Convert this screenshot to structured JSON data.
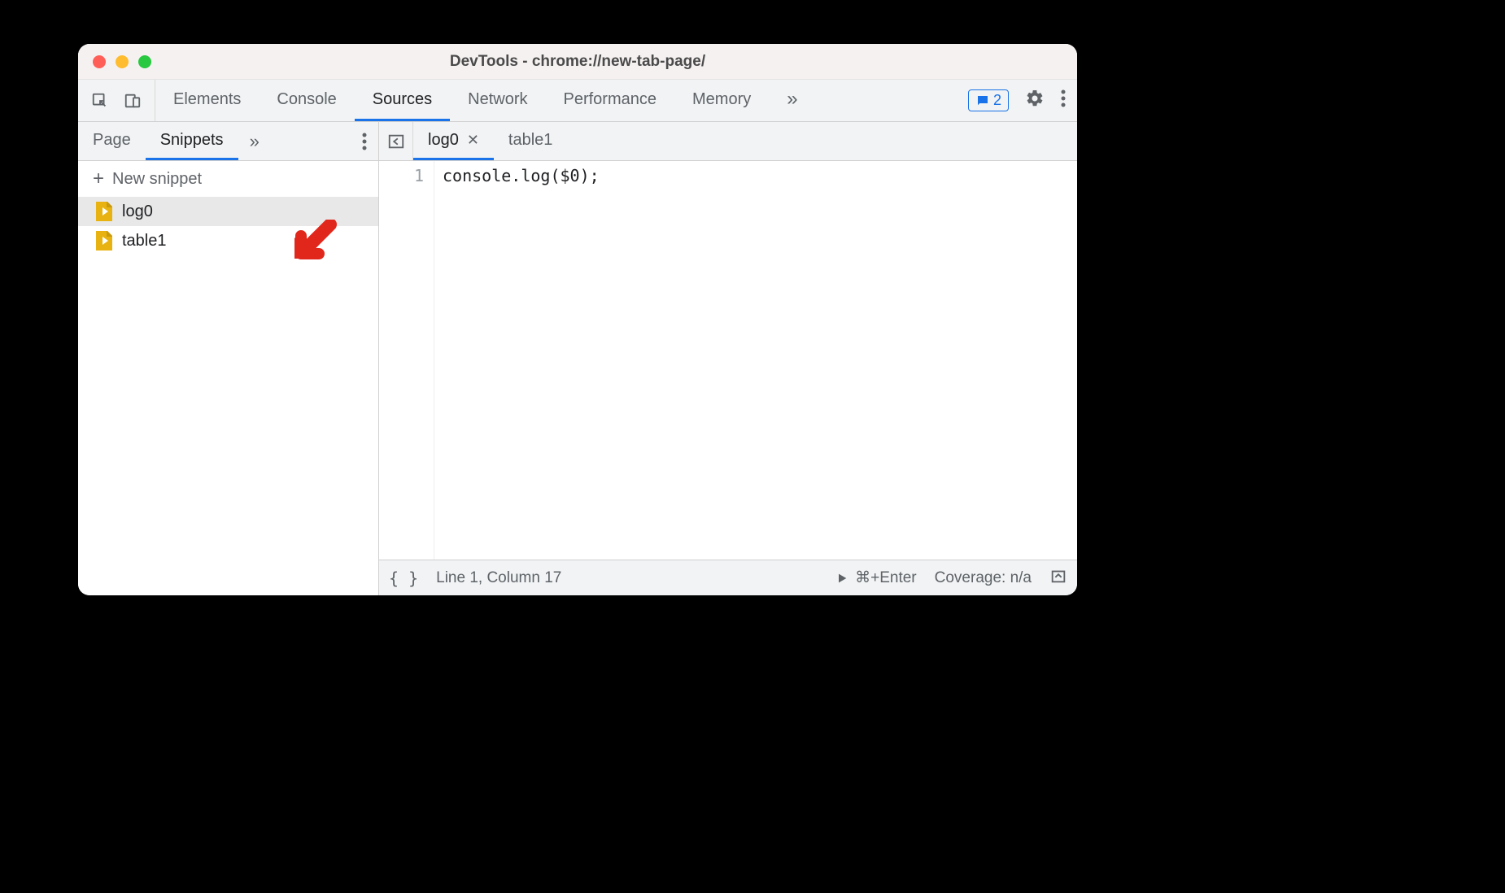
{
  "window": {
    "title": "DevTools - chrome://new-tab-page/"
  },
  "toolbar": {
    "tabs": [
      "Elements",
      "Console",
      "Sources",
      "Network",
      "Performance",
      "Memory"
    ],
    "active": "Sources",
    "overflowGlyph": "»",
    "badgeCount": "2"
  },
  "sidebar": {
    "tabs": [
      "Page",
      "Snippets"
    ],
    "active": "Snippets",
    "overflowGlyph": "»",
    "newSnippetLabel": "New snippet",
    "files": [
      {
        "name": "log0",
        "selected": true
      },
      {
        "name": "table1",
        "selected": false
      }
    ]
  },
  "editor": {
    "tabs": [
      {
        "name": "log0",
        "active": true,
        "closable": true
      },
      {
        "name": "table1",
        "active": false,
        "closable": false
      }
    ],
    "lineNumber": "1",
    "code": "console.log($0);"
  },
  "status": {
    "position": "Line 1, Column 17",
    "runShortcut": "⌘+Enter",
    "coverage": "Coverage: n/a"
  }
}
